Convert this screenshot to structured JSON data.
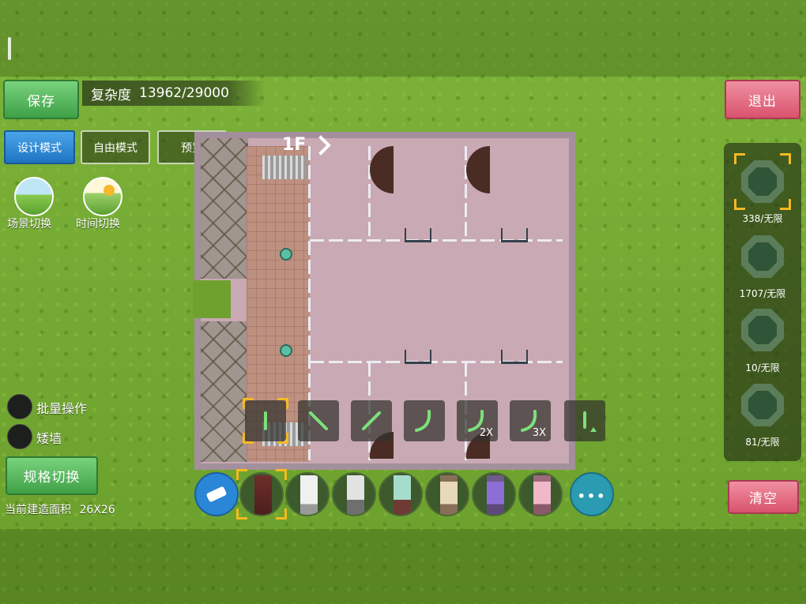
{
  "top": {
    "save_label": "保存",
    "complexity_label": "复杂度",
    "complexity_value": "13962/29000",
    "exit_label": "退出"
  },
  "modes": [
    {
      "label": "设计模式",
      "active": true
    },
    {
      "label": "自由模式",
      "active": false
    },
    {
      "label": "预览",
      "active": false
    }
  ],
  "left_icons": {
    "scene_label": "场景切换",
    "time_label": "时间切换"
  },
  "toggles": {
    "batch_label": "批量操作",
    "low_wall_label": "矮墙"
  },
  "spec_switch_label": "规格切换",
  "build_area": {
    "label": "当前建造面积",
    "value": "26X26"
  },
  "floor_label": "1F",
  "wall_tools": [
    {
      "shape": "straight-vertical",
      "mult": "",
      "selected": true
    },
    {
      "shape": "diagonal-down",
      "mult": ""
    },
    {
      "shape": "diagonal-up",
      "mult": ""
    },
    {
      "shape": "curve",
      "mult": ""
    },
    {
      "shape": "curve",
      "mult": "2X"
    },
    {
      "shape": "curve",
      "mult": "3X"
    },
    {
      "shape": "short-wall-up",
      "mult": ""
    }
  ],
  "materials": [
    {
      "name": "eraser-icon"
    },
    {
      "name": "brick-wall",
      "colors": [
        "#6e2e2a",
        "#4a1f1c"
      ],
      "selected": true
    },
    {
      "name": "white-panel-wall",
      "colors": [
        "#e8e8e8",
        "#b0b0b0"
      ]
    },
    {
      "name": "gray-stone-wall",
      "colors": [
        "#d8d8d8",
        "#7a7a7a"
      ]
    },
    {
      "name": "teal-brick-wall",
      "colors": [
        "#9fd6c2",
        "#6e3a34"
      ]
    },
    {
      "name": "beige-window-wall",
      "colors": [
        "#e8d9b8",
        "#8a6f58"
      ]
    },
    {
      "name": "purple-window-wall",
      "colors": [
        "#8c6fd6",
        "#4e3a7a"
      ]
    },
    {
      "name": "pink-window-wall",
      "colors": [
        "#f0b8c8",
        "#8a5a6a"
      ]
    },
    {
      "name": "more-icon"
    }
  ],
  "right_panel": [
    {
      "name": "wall-category",
      "count": "338/无限",
      "selected": true
    },
    {
      "name": "floor-category",
      "count": "1707/无限"
    },
    {
      "name": "door-window-category",
      "count": "10/无限"
    },
    {
      "name": "furniture-category",
      "count": "81/无限"
    }
  ],
  "clear_label": "清空",
  "colors": {
    "accent_blue": "#2a86d6",
    "accent_green": "#4cb154",
    "accent_red": "#e06a84",
    "selection": "#f5b921"
  }
}
